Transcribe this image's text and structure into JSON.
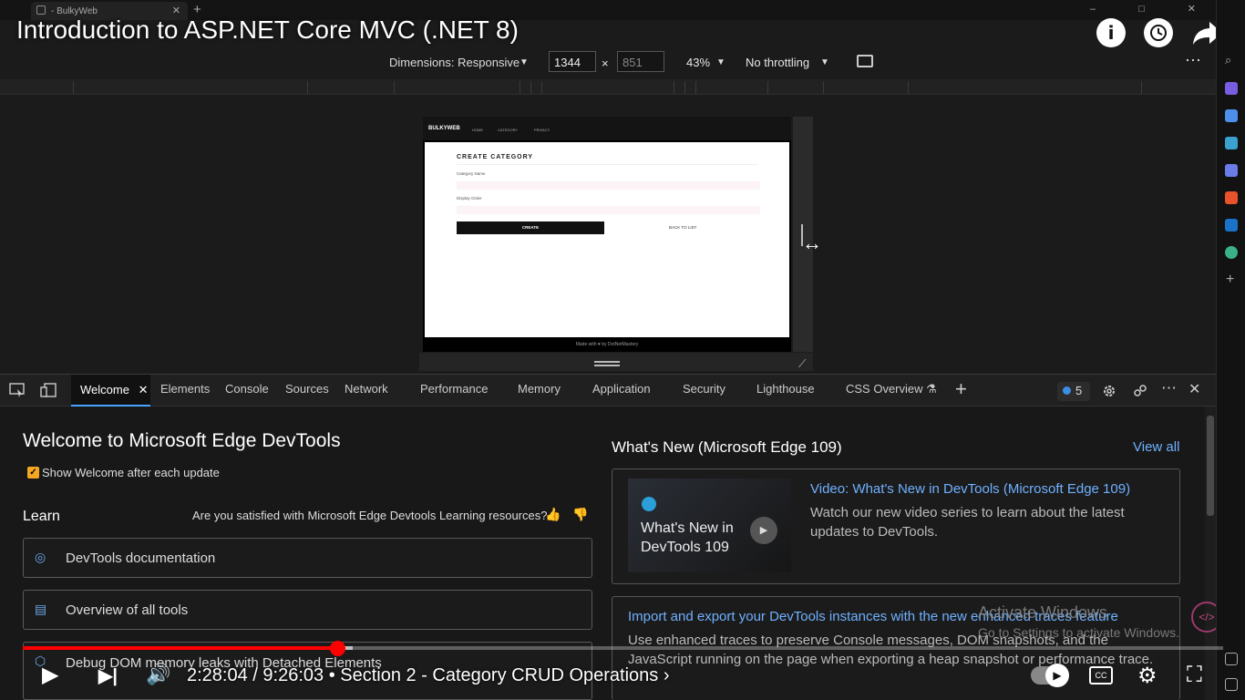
{
  "browser": {
    "tab_title": "- BulkyWeb",
    "tab_close": "✕",
    "new_tab": "+",
    "window_controls": "–  □  ✕"
  },
  "video": {
    "title": "Introduction to ASP.NET Core MVC (.NET 8)",
    "info_icon": "i",
    "watch_later_icon": "clock-icon",
    "share_icon": "share-icon",
    "time": "2:28:04 / 9:26:03",
    "chapter": "• Section 2 - Category CRUD Operations",
    "chapter_chevron": "›",
    "progress_fraction": 0.2617,
    "buffered_fraction": 0.2746,
    "accent": "#ff0000"
  },
  "device_toolbar": {
    "dimensions_label": "Dimensions: Responsive",
    "width": "1344",
    "times": "×",
    "height": "851",
    "zoom": "43%",
    "throttling": "No throttling",
    "dropdown_arrow": "▼",
    "more": "⋯"
  },
  "site": {
    "brand": "BULKYWEB",
    "nav": [
      "HOME",
      "CATEGORY",
      "PRIVACY"
    ],
    "heading": "CREATE CATEGORY",
    "field1_label": "Category Name",
    "field2_label": "Display Order",
    "create_button": "CREATE",
    "back_link": "BACK TO LIST",
    "footer": "Made with ♥ by DotNetMastery"
  },
  "devtools": {
    "tabs": {
      "welcome": "Welcome",
      "elements": "Elements",
      "console": "Console",
      "sources": "Sources",
      "network": "Network",
      "performance": "Performance",
      "memory": "Memory",
      "application": "Application",
      "security": "Security",
      "lighthouse": "Lighthouse",
      "css_overview": "CSS Overview"
    },
    "close_tab": "✕",
    "add_tab": "+",
    "issues_count": "5",
    "close": "✕",
    "more": "⋯",
    "settings_icon": "gear-icon",
    "accent": "#4aa3ff"
  },
  "welcome": {
    "title": "Welcome to Microsoft Edge DevTools",
    "show_after_update": "Show Welcome after each update",
    "checkbox_mark": "✓",
    "learn_heading": "Learn",
    "feedback_question": "Are you satisfied with Microsoft Edge Devtools Learning resources?",
    "learn_items": [
      "DevTools documentation",
      "Overview of all tools",
      "Debug DOM memory leaks with Detached Elements"
    ],
    "whats_new_title": "What's New (Microsoft Edge 109)",
    "view_all": "View all",
    "video_thumb_line1": "What's New in",
    "video_thumb_line2": "DevTools 109",
    "news1_title": "Video: What's New in DevTools (Microsoft Edge 109)",
    "news1_body": "Watch our new video series to learn about the latest updates to DevTools.",
    "news2_title": "Import and export your DevTools instances with the new enhanced traces feature",
    "news2_body": "Use enhanced traces to preserve Console messages, DOM snapshots, and the JavaScript running on the page when exporting a heap snapshot or performance trace.",
    "play": "▶"
  },
  "watermark": {
    "line1": "Activate Windows",
    "line2": "Go to Settings to activate Windows."
  },
  "player_controls": {
    "play": "▶",
    "next": "▶|",
    "volume": "🔊",
    "autoplay": "▶",
    "cc": "CC",
    "settings": "⚙",
    "fullscreen": "⛶"
  }
}
